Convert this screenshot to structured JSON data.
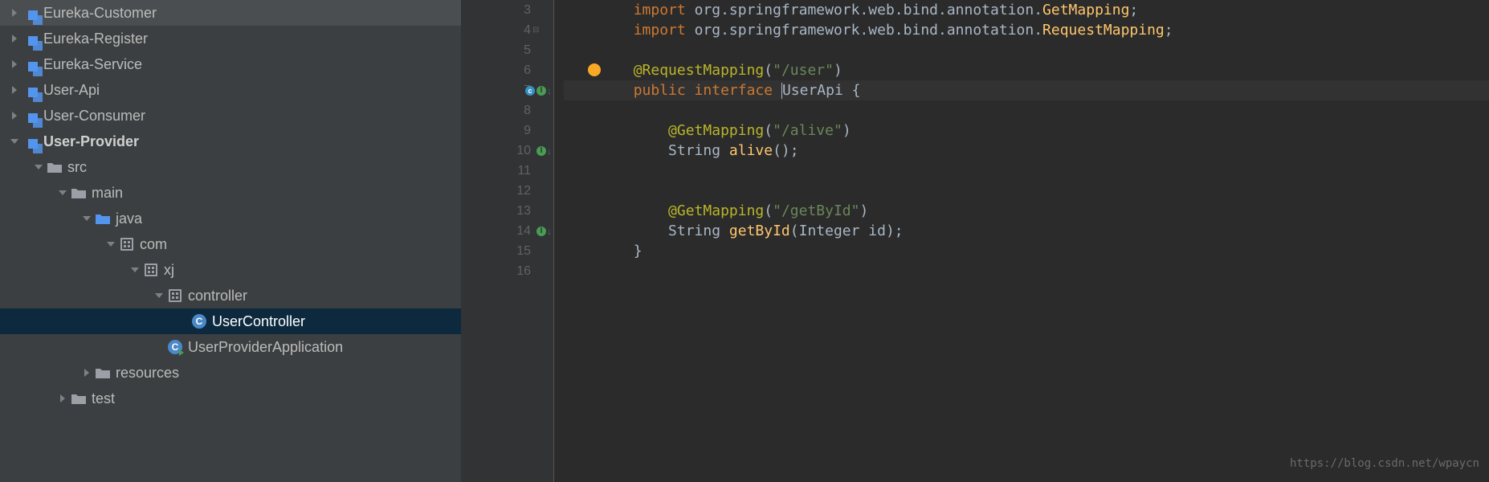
{
  "sidebar": {
    "items": [
      {
        "label": "Eureka-Customer",
        "type": "module",
        "indent": 0,
        "arrow": "right"
      },
      {
        "label": "Eureka-Register",
        "type": "module",
        "indent": 0,
        "arrow": "right"
      },
      {
        "label": "Eureka-Service",
        "type": "module",
        "indent": 0,
        "arrow": "right"
      },
      {
        "label": "User-Api",
        "type": "module",
        "indent": 0,
        "arrow": "right"
      },
      {
        "label": "User-Consumer",
        "type": "module",
        "indent": 0,
        "arrow": "right"
      },
      {
        "label": "User-Provider",
        "type": "module",
        "indent": 0,
        "arrow": "down",
        "bold": true
      },
      {
        "label": "src",
        "type": "folder",
        "indent": 1,
        "arrow": "down"
      },
      {
        "label": "main",
        "type": "folder",
        "indent": 2,
        "arrow": "down"
      },
      {
        "label": "java",
        "type": "folder-blue",
        "indent": 3,
        "arrow": "down"
      },
      {
        "label": "com",
        "type": "package",
        "indent": 4,
        "arrow": "down"
      },
      {
        "label": "xj",
        "type": "package",
        "indent": 5,
        "arrow": "down"
      },
      {
        "label": "controller",
        "type": "package",
        "indent": 6,
        "arrow": "down"
      },
      {
        "label": "UserController",
        "type": "class",
        "indent": 7,
        "arrow": "none",
        "selected": true
      },
      {
        "label": "UserProviderApplication",
        "type": "class-run",
        "indent": 6,
        "arrow": "none"
      },
      {
        "label": "resources",
        "type": "folder-res",
        "indent": 3,
        "arrow": "right"
      },
      {
        "label": "test",
        "type": "folder",
        "indent": 2,
        "arrow": "right"
      }
    ]
  },
  "editor": {
    "lines": [
      {
        "num": 3,
        "segments": [
          {
            "t": "        ",
            "c": ""
          },
          {
            "t": "import ",
            "c": "kw"
          },
          {
            "t": "org.springframework.web.bind.annotation.",
            "c": "pkg"
          },
          {
            "t": "GetMapping",
            "c": "import-end"
          },
          {
            "t": ";",
            "c": ""
          }
        ],
        "gutter": []
      },
      {
        "num": 4,
        "segments": [
          {
            "t": "        ",
            "c": ""
          },
          {
            "t": "import ",
            "c": "kw"
          },
          {
            "t": "org.springframework.web.bind.annotation.",
            "c": "pkg"
          },
          {
            "t": "RequestMapping",
            "c": "import-end"
          },
          {
            "t": ";",
            "c": ""
          }
        ],
        "gutter": [],
        "fold": true
      },
      {
        "num": 5,
        "segments": [
          {
            "t": "",
            "c": ""
          }
        ],
        "gutter": []
      },
      {
        "num": 6,
        "segments": [
          {
            "t": "        ",
            "c": ""
          },
          {
            "t": "@RequestMapping",
            "c": "ann"
          },
          {
            "t": "(",
            "c": ""
          },
          {
            "t": "\"/user\"",
            "c": "str"
          },
          {
            "t": ")",
            "c": ""
          }
        ],
        "gutter": [],
        "bulb": true
      },
      {
        "num": 7,
        "segments": [
          {
            "t": "        ",
            "c": ""
          },
          {
            "t": "public interface ",
            "c": "kw"
          },
          {
            "t": "UserApi ",
            "c": "cls",
            "caret": true
          },
          {
            "t": "{",
            "c": ""
          }
        ],
        "gutter": [
          "c",
          "impl"
        ],
        "current": true
      },
      {
        "num": 8,
        "segments": [
          {
            "t": "",
            "c": ""
          }
        ],
        "gutter": []
      },
      {
        "num": 9,
        "segments": [
          {
            "t": "            ",
            "c": ""
          },
          {
            "t": "@GetMapping",
            "c": "ann"
          },
          {
            "t": "(",
            "c": ""
          },
          {
            "t": "\"/alive\"",
            "c": "str"
          },
          {
            "t": ")",
            "c": ""
          }
        ],
        "gutter": []
      },
      {
        "num": 10,
        "segments": [
          {
            "t": "            ",
            "c": ""
          },
          {
            "t": "String ",
            "c": "type"
          },
          {
            "t": "alive",
            "c": "method"
          },
          {
            "t": "();",
            "c": ""
          }
        ],
        "gutter": [
          "impl"
        ]
      },
      {
        "num": 11,
        "segments": [
          {
            "t": "",
            "c": ""
          }
        ],
        "gutter": []
      },
      {
        "num": 12,
        "segments": [
          {
            "t": "",
            "c": ""
          }
        ],
        "gutter": []
      },
      {
        "num": 13,
        "segments": [
          {
            "t": "            ",
            "c": ""
          },
          {
            "t": "@GetMapping",
            "c": "ann"
          },
          {
            "t": "(",
            "c": ""
          },
          {
            "t": "\"/getById\"",
            "c": "str"
          },
          {
            "t": ")",
            "c": ""
          }
        ],
        "gutter": []
      },
      {
        "num": 14,
        "segments": [
          {
            "t": "            ",
            "c": ""
          },
          {
            "t": "String ",
            "c": "type"
          },
          {
            "t": "getById",
            "c": "method"
          },
          {
            "t": "(Integer id);",
            "c": ""
          }
        ],
        "gutter": [
          "impl"
        ]
      },
      {
        "num": 15,
        "segments": [
          {
            "t": "        }",
            "c": ""
          }
        ],
        "gutter": []
      },
      {
        "num": 16,
        "segments": [
          {
            "t": "",
            "c": ""
          }
        ],
        "gutter": []
      }
    ]
  },
  "watermark": "https://blog.csdn.net/wpaycn"
}
